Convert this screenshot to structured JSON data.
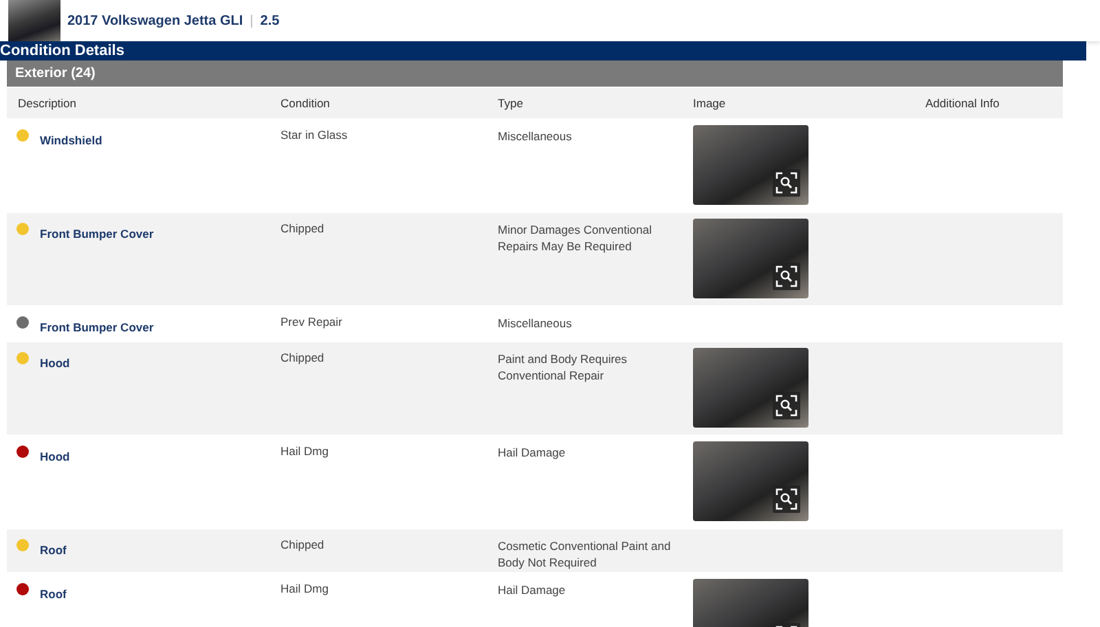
{
  "vehicle": {
    "title": "2017 Volkswagen Jetta GLI",
    "separator": "|",
    "trim": "2.5"
  },
  "section": {
    "title": "Condition Details"
  },
  "group": {
    "title": "Exterior (24)"
  },
  "table": {
    "columns": [
      "Description",
      "Condition",
      "Type",
      "Image",
      "Additional Info"
    ],
    "rows": [
      {
        "description": "Windshield",
        "color": "#f2c52e",
        "condition": "Star in Glass",
        "type": "Miscellaneous",
        "has_image": true
      },
      {
        "description": "Front Bumper Cover",
        "color": "#f2c52e",
        "condition": "Chipped",
        "type": "Minor Damages Conventional Repairs May Be Required",
        "has_image": true
      },
      {
        "description": "Front Bumper Cover",
        "color": "#6e6e6e",
        "condition": "Prev Repair",
        "type": "Miscellaneous",
        "has_image": false
      },
      {
        "description": "Hood",
        "color": "#f2c52e",
        "condition": "Chipped",
        "type": "Paint and Body Requires Conventional Repair",
        "has_image": true
      },
      {
        "description": "Hood",
        "color": "#b00a0a",
        "condition": "Hail Dmg",
        "type": "Hail Damage",
        "has_image": true
      },
      {
        "description": "Roof",
        "color": "#f2c52e",
        "condition": "Chipped",
        "type": "Cosmetic Conventional Paint and Body Not Required",
        "has_image": false
      },
      {
        "description": "Roof",
        "color": "#b00a0a",
        "condition": "Hail Dmg",
        "type": "Hail Damage",
        "has_image": true
      }
    ]
  }
}
